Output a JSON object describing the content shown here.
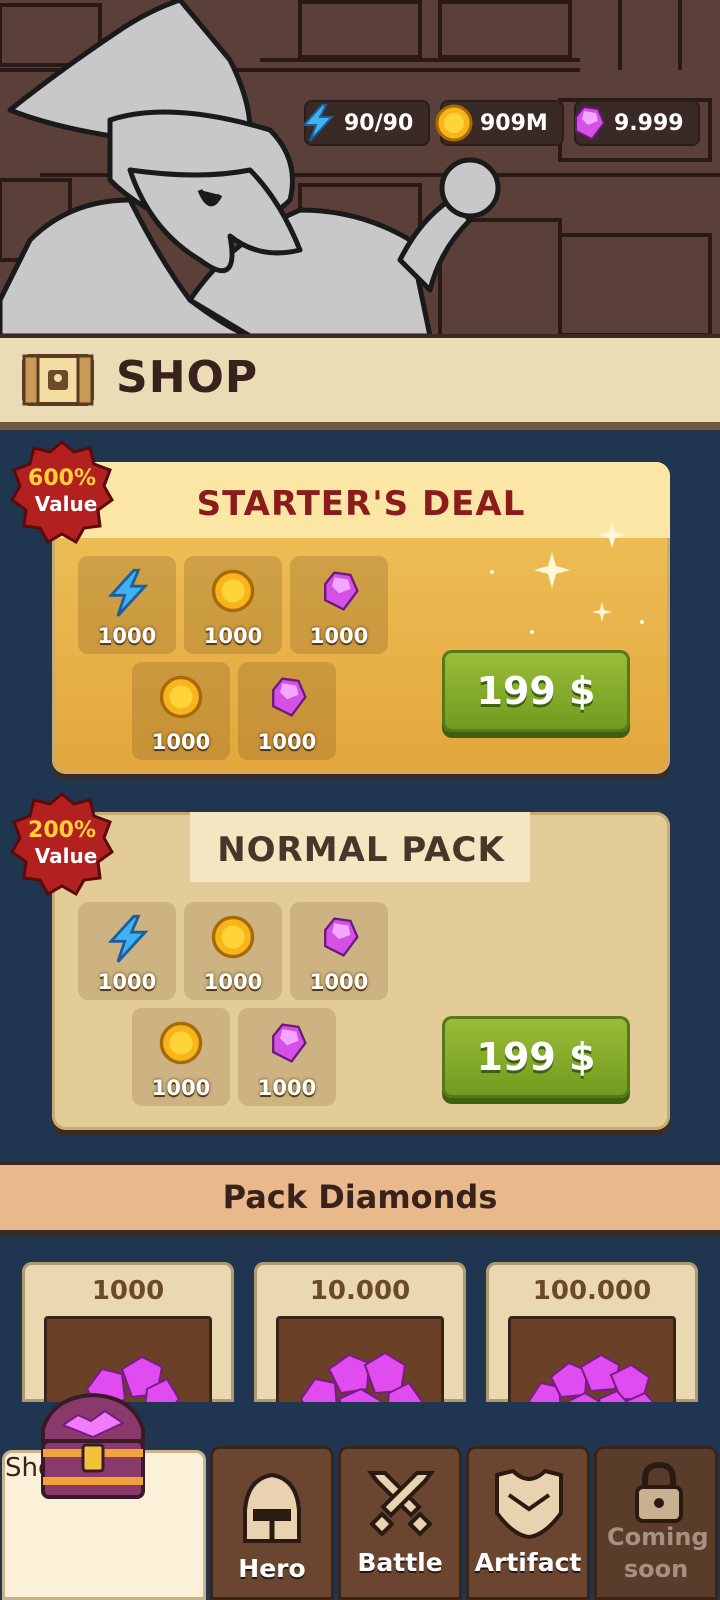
{
  "resources": {
    "energy": {
      "value": "90/90",
      "icon": "lightning-icon"
    },
    "gold": {
      "value": "909M",
      "icon": "coin-icon"
    },
    "gems": {
      "value": "9.999",
      "icon": "gem-icon"
    }
  },
  "shop": {
    "title": "SHOP",
    "icon": "chest-icon"
  },
  "starter_deal": {
    "title": "STARTER'S DEAL",
    "badge": {
      "line1": "600%",
      "line2": "Value"
    },
    "items": [
      {
        "icon": "lightning-icon",
        "qty": "1000"
      },
      {
        "icon": "coin-icon",
        "qty": "1000"
      },
      {
        "icon": "gem-icon",
        "qty": "1000"
      },
      {
        "icon": "coin-icon",
        "qty": "1000"
      },
      {
        "icon": "gem-icon",
        "qty": "1000"
      }
    ],
    "price": "199 $"
  },
  "normal_pack": {
    "title": "NORMAL PACK",
    "badge": {
      "line1": "200%",
      "line2": "Value"
    },
    "items": [
      {
        "icon": "lightning-icon",
        "qty": "1000"
      },
      {
        "icon": "coin-icon",
        "qty": "1000"
      },
      {
        "icon": "gem-icon",
        "qty": "1000"
      },
      {
        "icon": "coin-icon",
        "qty": "1000"
      },
      {
        "icon": "gem-icon",
        "qty": "1000"
      }
    ],
    "price": "199 $"
  },
  "pack_diamonds": {
    "title": "Pack Diamonds",
    "packs": [
      {
        "amount": "1000"
      },
      {
        "amount": "10.000"
      },
      {
        "amount": "100.000"
      }
    ]
  },
  "nav": {
    "tabs": [
      {
        "label": "Shop",
        "icon": "treasure-chest-icon",
        "active": true
      },
      {
        "label": "Hero",
        "icon": "helmet-icon"
      },
      {
        "label": "Battle",
        "icon": "crossed-swords-icon"
      },
      {
        "label": "Artifact",
        "icon": "armor-icon"
      },
      {
        "label": "Coming soon",
        "icon": "lock-icon",
        "locked": true
      }
    ]
  },
  "colors": {
    "background": "#1f3550",
    "title_red": "#8a1c1c",
    "buy_green": "#7ea52a",
    "badge_red": "#b32020"
  }
}
